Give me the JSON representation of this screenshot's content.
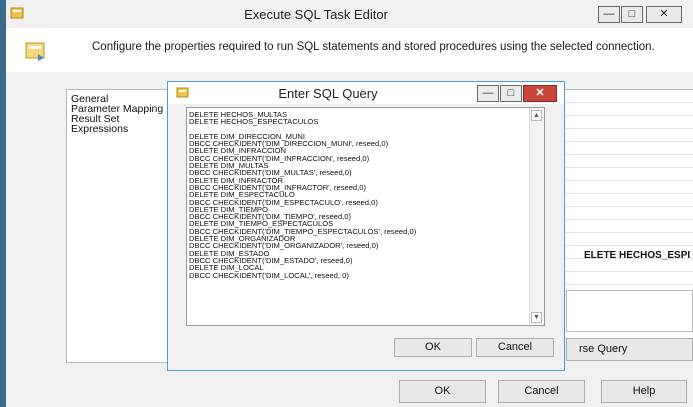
{
  "outer_window": {
    "title": "Execute SQL Task Editor",
    "header_text": "Configure the properties required to run SQL statements and stored procedures using the selected connection.",
    "nav_items": [
      "General",
      "Parameter Mapping",
      "Result Set",
      "Expressions"
    ],
    "grid_value": "ELETE HECHOS_ESPI",
    "parse_query_label": "rse Query",
    "ok_label": "OK",
    "cancel_label": "Cancel",
    "help_label": "Help",
    "minimize_glyph": "—",
    "maximize_glyph": "□",
    "close_glyph": "✕"
  },
  "dialog": {
    "title": "Enter SQL Query",
    "sql_text": "DELETE HECHOS_MULTAS\nDELETE HECHOS_ESPECTACULOS\n\nDELETE DIM_DIRECCION_MUNI\nDBCC CHECKIDENT('DIM_DIRECCION_MUNI', reseed,0)\nDELETE DIM_INFRACCION\nDBCC CHECKIDENT('DIM_INFRACCION', reseed,0)\nDELETE DIM_MULTAS\nDBCC CHECKIDENT('DIM_MULTAS', reseed,0)\nDELETE DIM_INFRACTOR\nDBCC CHECKIDENT('DIM_INFRACTOR', reseed,0)\nDELETE DIM_ESPECTACULO\nDBCC CHECKIDENT('DIM_ESPECTACULO', reseed,0)\nDELETE DIM_TIEMPO\nDBCC CHECKIDENT('DIM_TIEMPO', reseed,0)\nDELETE DIM_TIEMPO_ESPECTACULOS\nDBCC CHECKIDENT('DIM_TIEMPO_ESPECTACULOS', reseed,0)\nDELETE DIM_ORGANIZADOR\nDBCC CHECKIDENT('DIM_ORGANIZADOR', reseed,0)\nDELETE DIM_ESTADO\nDBCC CHECKIDENT('DIM_ESTADO', reseed,0)\nDELETE DIM_LOCAL\nDBCC CHECKIDENT('DIM_LOCAL', reseed, 0)",
    "ok_label": "OK",
    "cancel_label": "Cancel",
    "minimize_glyph": "—",
    "maximize_glyph": "□",
    "close_glyph": "✕"
  },
  "icons": {
    "outer_app_icon": "dialog-app-icon",
    "header_icon": "task-icon",
    "dialog_app_icon": "dialog-app-icon"
  },
  "colors": {
    "window_border": "#4a9fd8",
    "close_button": "#c8453a"
  }
}
